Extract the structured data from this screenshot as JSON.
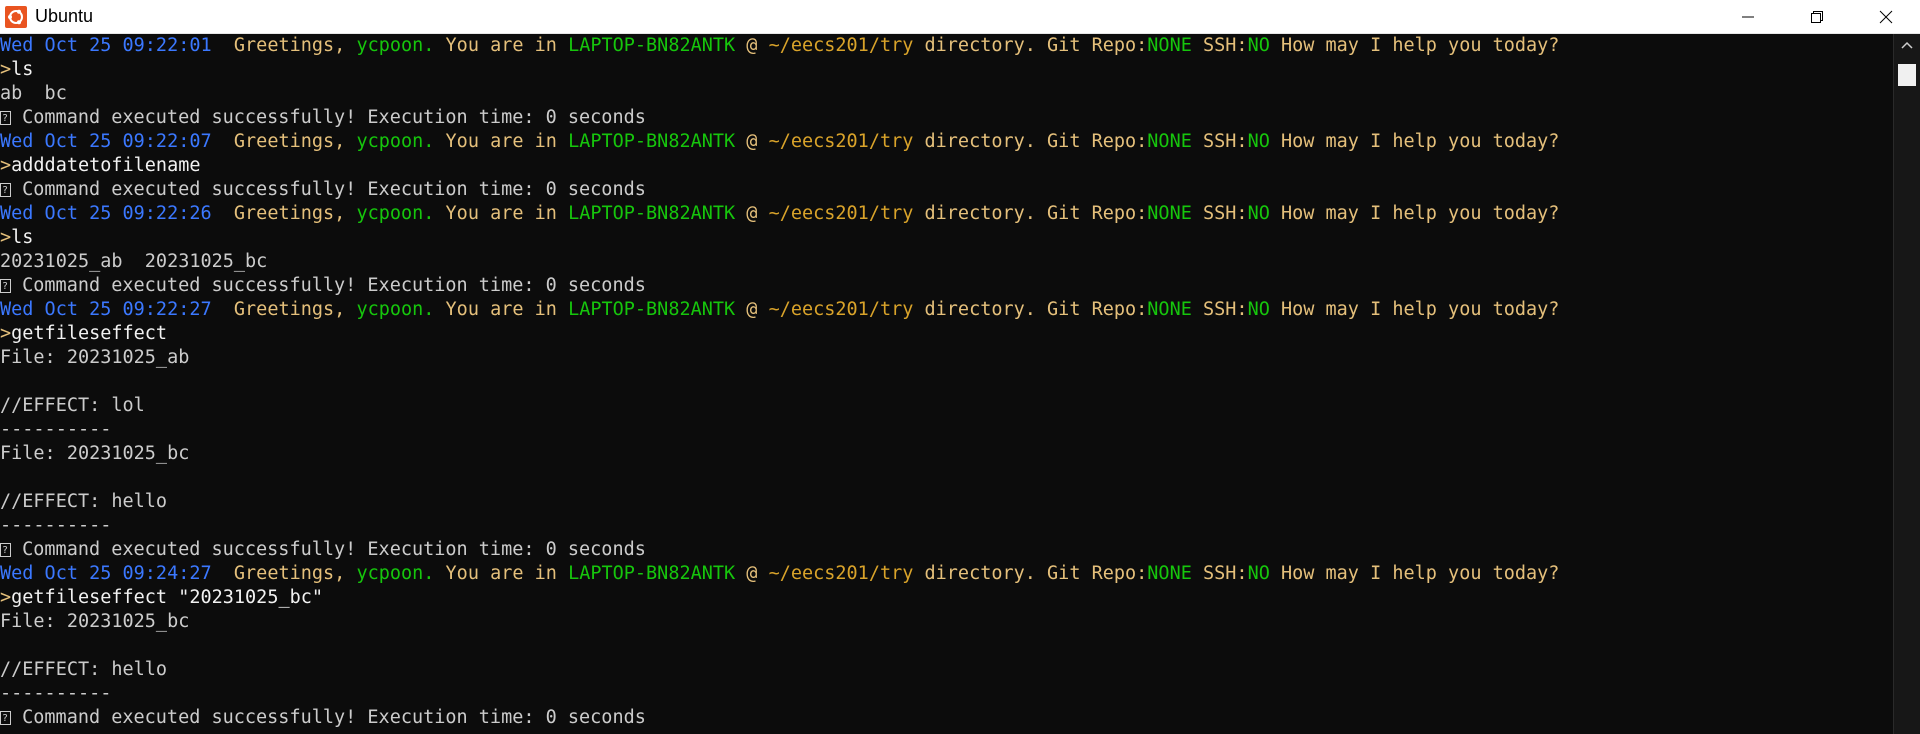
{
  "window": {
    "title": "Ubuntu",
    "icon": "ubuntu-logo-icon",
    "controls": [
      "minimize-icon",
      "restore-icon",
      "close-icon"
    ]
  },
  "colors": {
    "date": "#3b78ff",
    "greeting": "#e5c07b",
    "user": "#16c60c",
    "host": "#16c60c",
    "path": "#d9a32a",
    "text": "#cccccc",
    "background": "#0c0c0c"
  },
  "prompt": {
    "greeting": "Greetings,",
    "user": "ycpoon.",
    "you_are_in": "You are in",
    "host": "LAPTOP-BN82ANTK",
    "at": "@",
    "path": "~/eecs201/try",
    "directory": "directory.",
    "git_label": "Git Repo:",
    "git_value": "NONE",
    "ssh_label": "SSH:",
    "ssh_value": "NO",
    "question": "How may I help you today?"
  },
  "lines": [
    {
      "type": "prompt",
      "date": "Wed Oct 25 09:22:01"
    },
    {
      "type": "cmd",
      "text": "ls"
    },
    {
      "type": "out",
      "text": "ab  bc"
    },
    {
      "type": "status",
      "text": " Command executed successfully! Execution time: 0 seconds"
    },
    {
      "type": "prompt",
      "date": "Wed Oct 25 09:22:07"
    },
    {
      "type": "cmd",
      "text": "adddatetofilename"
    },
    {
      "type": "status",
      "text": " Command executed successfully! Execution time: 0 seconds"
    },
    {
      "type": "prompt",
      "date": "Wed Oct 25 09:22:26"
    },
    {
      "type": "cmd",
      "text": "ls"
    },
    {
      "type": "out",
      "text": "20231025_ab  20231025_bc"
    },
    {
      "type": "status",
      "text": " Command executed successfully! Execution time: 0 seconds"
    },
    {
      "type": "prompt",
      "date": "Wed Oct 25 09:22:27"
    },
    {
      "type": "cmd",
      "text": "getfileseffect"
    },
    {
      "type": "out",
      "text": "File: 20231025_ab"
    },
    {
      "type": "out",
      "text": ""
    },
    {
      "type": "out",
      "text": "//EFFECT: lol"
    },
    {
      "type": "out",
      "text": "----------"
    },
    {
      "type": "out",
      "text": "File: 20231025_bc"
    },
    {
      "type": "out",
      "text": ""
    },
    {
      "type": "out",
      "text": "//EFFECT: hello"
    },
    {
      "type": "out",
      "text": "----------"
    },
    {
      "type": "status",
      "text": " Command executed successfully! Execution time: 0 seconds"
    },
    {
      "type": "prompt",
      "date": "Wed Oct 25 09:24:27"
    },
    {
      "type": "cmd",
      "text": "getfileseffect \"20231025_bc\""
    },
    {
      "type": "out",
      "text": "File: 20231025_bc"
    },
    {
      "type": "out",
      "text": ""
    },
    {
      "type": "out",
      "text": "//EFFECT: hello"
    },
    {
      "type": "out",
      "text": "----------"
    },
    {
      "type": "status",
      "text": " Command executed successfully! Execution time: 0 seconds"
    }
  ]
}
